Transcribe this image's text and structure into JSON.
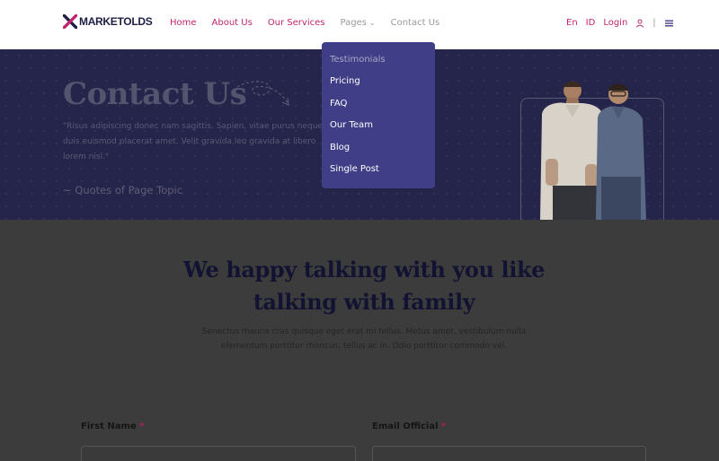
{
  "logo": {
    "text": "MARKETOLDS"
  },
  "nav": [
    {
      "label": "Home"
    },
    {
      "label": "About Us"
    },
    {
      "label": "Our Services"
    },
    {
      "label": "Pages"
    },
    {
      "label": "Contact Us"
    }
  ],
  "header_tools": {
    "lang_en": "En",
    "lang_id": "ID",
    "login": "Login",
    "separator": "|"
  },
  "dropdown": [
    {
      "label": "Testimonials"
    },
    {
      "label": "Pricing"
    },
    {
      "label": "FAQ"
    },
    {
      "label": "Our Team"
    },
    {
      "label": "Blog"
    },
    {
      "label": "Single Post"
    }
  ],
  "hero": {
    "title": "Contact Us",
    "quote": "\"Risus adipiscing donec nam sagittis. Sapien, vitae purus neque duis euismod placerat amet. Velit gravida leo gravida at libero lorem nisl.\"",
    "cite": "~ Quotes of Page Topic"
  },
  "section": {
    "title_line1": "We happy talking with you like",
    "title_line2": "talking with family",
    "subtitle": "Senectus mauris cras quisque eget erat mi tellus. Metus amet, vestibulum nulla elementum porttitor rhoncus, tellus ac in. Odio porttitor commodo vel."
  },
  "form": {
    "first_name_label": "First Name",
    "email_label": "Email Official",
    "required_mark": "*"
  },
  "colors": {
    "brand_pink": "#c0246d",
    "hero_bg": "#25244a",
    "dropdown_bg": "#3f3e86",
    "overlay_bg": "#3c3c3c"
  }
}
